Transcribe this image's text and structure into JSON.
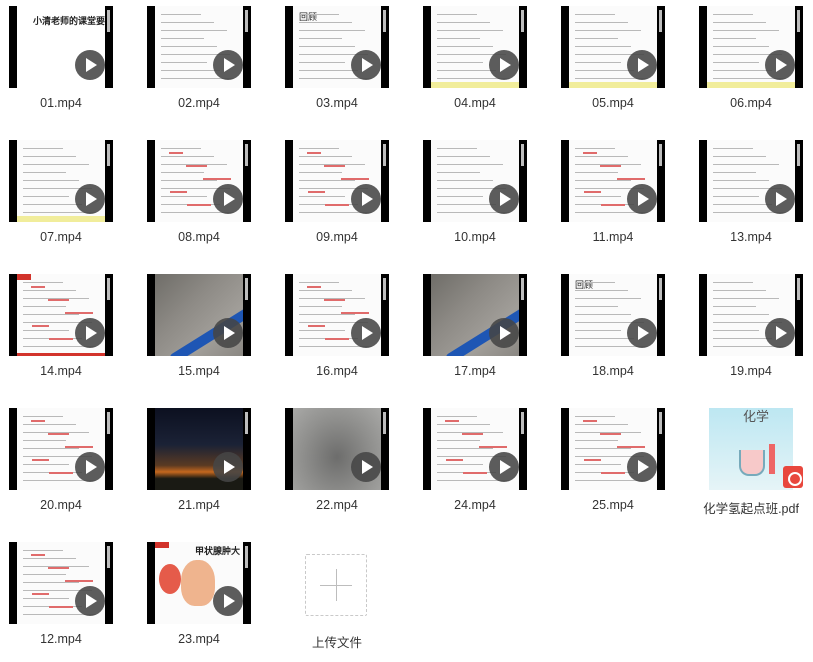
{
  "files": [
    {
      "name": "01.mp4",
      "kind": "video",
      "thumb": "slide-title",
      "thumb_text": "小清老师的课堂要求"
    },
    {
      "name": "02.mp4",
      "kind": "video",
      "thumb": "doc"
    },
    {
      "name": "03.mp4",
      "kind": "video",
      "thumb": "doc-diagram",
      "thumb_text": "回顾"
    },
    {
      "name": "04.mp4",
      "kind": "video",
      "thumb": "doc-yellow"
    },
    {
      "name": "05.mp4",
      "kind": "video",
      "thumb": "doc-table"
    },
    {
      "name": "06.mp4",
      "kind": "video",
      "thumb": "doc-yellow"
    },
    {
      "name": "07.mp4",
      "kind": "video",
      "thumb": "doc-table"
    },
    {
      "name": "08.mp4",
      "kind": "video",
      "thumb": "doc-red"
    },
    {
      "name": "09.mp4",
      "kind": "video",
      "thumb": "doc-red"
    },
    {
      "name": "10.mp4",
      "kind": "video",
      "thumb": "doc"
    },
    {
      "name": "11.mp4",
      "kind": "video",
      "thumb": "doc-red"
    },
    {
      "name": "13.mp4",
      "kind": "video",
      "thumb": "doc"
    },
    {
      "name": "14.mp4",
      "kind": "video",
      "thumb": "slide-red"
    },
    {
      "name": "15.mp4",
      "kind": "video",
      "thumb": "photo-pen"
    },
    {
      "name": "16.mp4",
      "kind": "video",
      "thumb": "doc-red"
    },
    {
      "name": "17.mp4",
      "kind": "video",
      "thumb": "photo-pen"
    },
    {
      "name": "18.mp4",
      "kind": "video",
      "thumb": "doc-diagram",
      "thumb_text": "回顾"
    },
    {
      "name": "19.mp4",
      "kind": "video",
      "thumb": "doc"
    },
    {
      "name": "20.mp4",
      "kind": "video",
      "thumb": "doc-red"
    },
    {
      "name": "21.mp4",
      "kind": "video",
      "thumb": "photo-night"
    },
    {
      "name": "22.mp4",
      "kind": "video",
      "thumb": "photo-gray"
    },
    {
      "name": "24.mp4",
      "kind": "video",
      "thumb": "doc-red"
    },
    {
      "name": "25.mp4",
      "kind": "video",
      "thumb": "doc-red"
    },
    {
      "name": "化学氢起点班.pdf",
      "kind": "pdf",
      "thumb": "pdf-cover",
      "thumb_text": "化学"
    },
    {
      "name": "12.mp4",
      "kind": "video",
      "thumb": "doc-red"
    },
    {
      "name": "23.mp4",
      "kind": "video",
      "thumb": "slide-face",
      "thumb_text": "甲状腺肿大"
    }
  ],
  "upload": {
    "label": "上传文件"
  },
  "icons": {
    "play": "play-icon",
    "pdf": "pdf-icon",
    "upload": "plus-icon"
  }
}
